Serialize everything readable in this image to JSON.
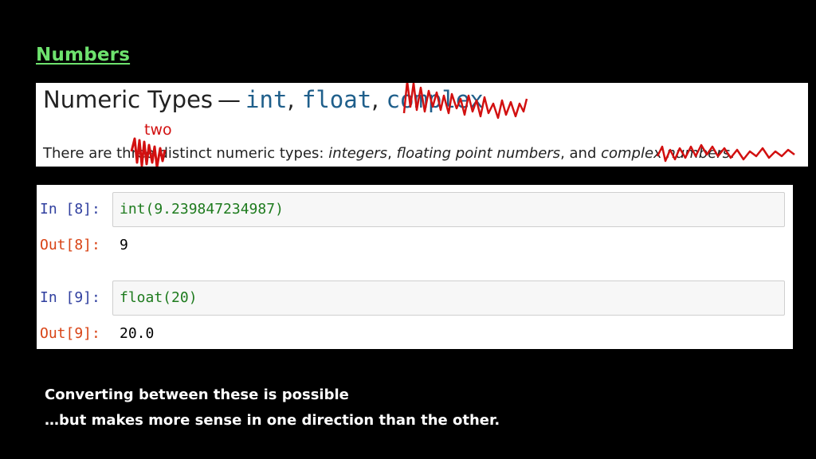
{
  "slide": {
    "title": "Numbers",
    "caption_line1": "Converting between these is possible",
    "caption_line2": "…but makes more sense in one direction than the other."
  },
  "docs": {
    "heading_prefix": "Numeric Types",
    "heading_dash": "—",
    "heading_code1": "int",
    "heading_sep1": ",",
    "heading_code2": "float",
    "heading_sep2": ",",
    "heading_code3": "complex",
    "text_before": "There are ",
    "text_struck": "three",
    "text_mid": " distinct numeric types: ",
    "type1": "integers",
    "sep1": ", ",
    "type2": "floating point numbers",
    "sep2": ", and ",
    "type3": "complex numbers",
    "text_end": ".",
    "handwritten_correction": "two"
  },
  "notebook": {
    "cells": [
      {
        "in_prompt": "In [8]:",
        "code": "int(9.239847234987)",
        "out_prompt": "Out[8]:",
        "output": "9"
      },
      {
        "in_prompt": "In [9]:",
        "code": "float(20)",
        "out_prompt": "Out[9]:",
        "output": "20.0"
      }
    ]
  },
  "colors": {
    "background": "#000000",
    "title": "#6ee26e",
    "annotation": "#d21010",
    "code_builtin": "#1f5f8b",
    "prompt_in": "#303f9f",
    "prompt_out": "#d84315",
    "code_text": "#1e7b1e"
  }
}
